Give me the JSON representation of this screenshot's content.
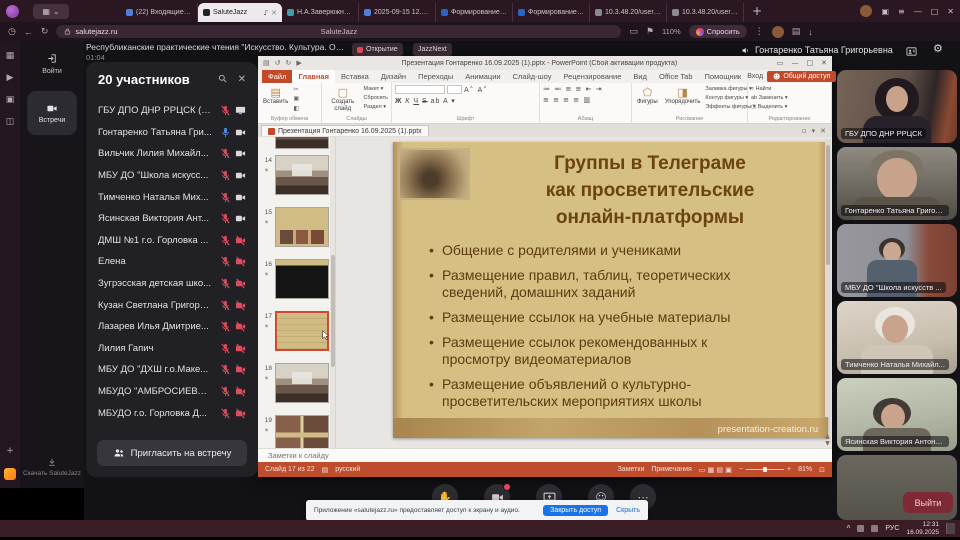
{
  "browser": {
    "tabs": [
      {
        "label": "(22) Входящие - П...",
        "color": "#4f7fd9",
        "active": false
      },
      {
        "label": "SaluteJazz",
        "color": "#23222a",
        "active": true
      },
      {
        "label": "Н.А.Заверюжнова...",
        "color": "#3aa0a8",
        "active": false
      },
      {
        "label": "2025-09-15 12.12...",
        "color": "#4f7fd9",
        "active": false
      },
      {
        "label": "Формирование и...",
        "color": "#2b64c4",
        "active": false
      },
      {
        "label": "Формирование и...",
        "color": "#2b64c4",
        "active": false
      },
      {
        "label": "10.3.48.20/user/d...",
        "color": "#8a8a92",
        "active": false
      },
      {
        "label": "10.3.48.20/user/d...",
        "color": "#8a8a92",
        "active": false
      }
    ],
    "url": "salutejazz.ru",
    "page_title": "SaluteJazz",
    "zoom_level": "110%",
    "ask_label": "Спросить"
  },
  "sidebar": {
    "login_label": "Войти",
    "meetings_label": "Встречи",
    "download_label": "Скачать SaluteJazz"
  },
  "meeting": {
    "title": "Республиканские практические чтения \"Искусство. Культура. Образован...",
    "timer": "01:04",
    "badge_recording": "Открытие",
    "badge_platform": "JazzNext",
    "speaker_name": "Гонтаренко Татьяна Григорьевна",
    "leave_label": "Выйти",
    "participants": {
      "header": "20 участников",
      "invite_label": "Пригласить на встречу",
      "items": [
        {
          "name": "ГБУ ДПО ДНР РРЦСК (Вы)",
          "mic": "muted",
          "video": "screen"
        },
        {
          "name": "Гонтаренко Татьяна Гри...",
          "mic": "speaking",
          "video": "on"
        },
        {
          "name": "Вильчик Лилия Михайл...",
          "mic": "muted",
          "video": "on"
        },
        {
          "name": "МБУ ДО \"Школа искусс...",
          "mic": "muted",
          "video": "on"
        },
        {
          "name": "Тимченко Наталья Мих...",
          "mic": "muted",
          "video": "on"
        },
        {
          "name": "Ясинская Виктория Ант...",
          "mic": "muted",
          "video": "on"
        },
        {
          "name": "ДМШ №1 г.о. Горловка ...",
          "mic": "muted",
          "video": "off"
        },
        {
          "name": "Елена",
          "mic": "muted",
          "video": "off"
        },
        {
          "name": "Зугрэсская детская шко...",
          "mic": "muted",
          "video": "off"
        },
        {
          "name": "Кузан Светлана Григорь...",
          "mic": "muted",
          "video": "off"
        },
        {
          "name": "Лазарев Илья Дмитрие...",
          "mic": "muted",
          "video": "off"
        },
        {
          "name": "Лилия Гапич",
          "mic": "muted",
          "video": "off"
        },
        {
          "name": "МБУ ДО \"ДХШ г.о.Маке...",
          "mic": "muted",
          "video": "off"
        },
        {
          "name": "МБУДО \"АМБРОСИЕВС...",
          "mic": "muted",
          "video": "off"
        },
        {
          "name": "МБУДО г.о. Горловка Д...",
          "mic": "muted",
          "video": "off"
        }
      ]
    },
    "tiles": [
      {
        "name": "ГБУ ДПО ДНР РРЦСК"
      },
      {
        "name": "Гонтаренко Татьяна Григорьевна"
      },
      {
        "name": "МБУ ДО \"Школа искусств ..."
      },
      {
        "name": "Тимченко Наталья Михайл..."
      },
      {
        "name": "Ясинская Виктория Антоно..."
      },
      {
        "name": ""
      }
    ]
  },
  "powerpoint": {
    "window_title": "Презентация Гонтаренко 16.09.2025 (1).pptx - PowerPoint (Сбой активации продукта)",
    "ribbon_tabs": [
      "Файл",
      "Главная",
      "Вставка",
      "Дизайн",
      "Переходы",
      "Анимации",
      "Слайд-шоу",
      "Рецензирование",
      "Вид",
      "Office Tab",
      "Помощник"
    ],
    "signin_label": "Вход",
    "share_label": "Общий доступ",
    "ribbon": {
      "paste": "Вставить",
      "new_slide": "Создать слайд",
      "layout": "Макет",
      "reset": "Сбросить",
      "section": "Раздел",
      "shapes": "Фигуры",
      "arrange": "Упорядочить",
      "fill": "Заливка фигуры",
      "outline": "Контур фигуры",
      "effects": "Эффекты фигуры",
      "find": "Найти",
      "replace": "Заменить",
      "select": "Выделить"
    },
    "group_labels": [
      "Буфер обмена",
      "Слайды",
      "Шрифт",
      "Абзац",
      "Рисование",
      "Редактирование"
    ],
    "doc_tab": "Презентация Гонтаренко 16.09.2025 (1).pptx",
    "thumbnails": [
      {
        "n": "14",
        "kind": "photo",
        "selected": false
      },
      {
        "n": "15",
        "kind": "slide15",
        "selected": false
      },
      {
        "n": "16",
        "kind": "black",
        "selected": false
      },
      {
        "n": "17",
        "kind": "current",
        "selected": true
      },
      {
        "n": "18",
        "kind": "photo",
        "selected": false
      },
      {
        "n": "19",
        "kind": "grid",
        "selected": false
      }
    ],
    "slide": {
      "title_lines": [
        "Группы в Телеграме",
        "как просветительские",
        "онлайн-платформы"
      ],
      "bullets": [
        "Общение с родителями и учениками",
        "Размещение правил, таблиц, теоретических сведений, домашних заданий",
        "Размещение ссылок на учебные материалы",
        "Размещение ссылок рекомендованных к просмотру видеоматериалов",
        "Размещение объявлений о культурно-просветительских мероприятиях школы"
      ],
      "watermark": "presentation-creation.ru"
    },
    "notes_placeholder": "Заметки к слайду",
    "status": {
      "slide_counter": "Слайд 17 из 22",
      "language": "русский",
      "notes": "Заметки",
      "comments": "Примечания",
      "zoom": "81%"
    }
  },
  "notification": {
    "text": "Приложение «salutejazz.ru» предоставляет доступ к экрану и аудио.",
    "stop_label": "Закрыть доступ",
    "hide_label": "Скрыть"
  },
  "taskbar": {
    "lang": "РУС",
    "time": "12:31",
    "date": "16.09.2025"
  },
  "colors": {
    "ppt_accent": "#b7472a",
    "mic_muted": "#e14b5e",
    "mic_active": "#4f8fe8",
    "leave_button": "#7e2a36",
    "notification_action": "#1a73e8"
  },
  "icons": {
    "search": "magnifier-svg",
    "settings": "⚙",
    "close": "✕",
    "add": "+",
    "tab_audio": "♪",
    "menu": "≡",
    "back": "←",
    "reload": "↻",
    "mic": "mic-svg",
    "camera": "camera-svg",
    "screen_share": "monitor-svg",
    "download": "arrow-down-svg"
  }
}
